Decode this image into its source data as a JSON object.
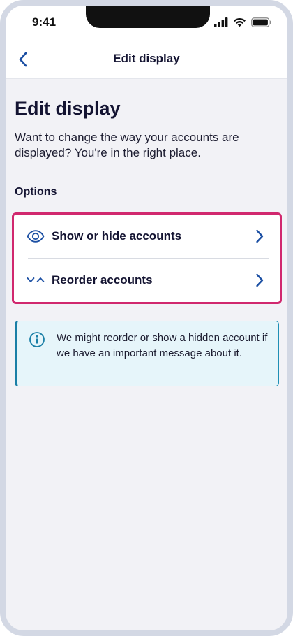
{
  "status_bar": {
    "time": "9:41"
  },
  "nav": {
    "title": "Edit display",
    "back_icon": "chevron-left-icon"
  },
  "page": {
    "title": "Edit display",
    "intro": "Want to change the way your accounts are displayed? You're in the right place.",
    "section_label": "Options"
  },
  "options": [
    {
      "label": "Show or hide accounts",
      "icon": "eye-icon"
    },
    {
      "label": "Reorder accounts",
      "icon": "reorder-icon"
    }
  ],
  "info": {
    "icon": "info-icon",
    "text": "We might reorder or show a hidden account if we have an important message about it."
  },
  "colors": {
    "accent": "#1b4fa3",
    "highlight_border": "#d1286e",
    "info_border": "#1a7fa6",
    "info_background": "#e6f5fa"
  }
}
